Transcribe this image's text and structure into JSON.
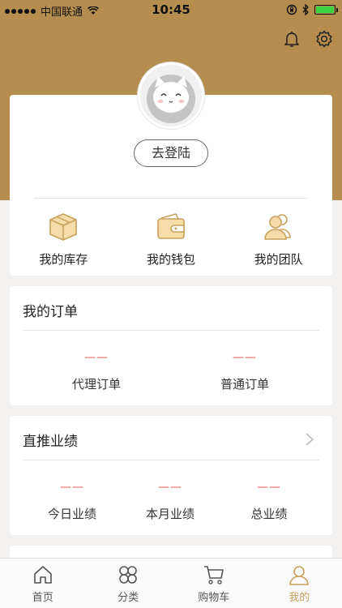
{
  "status_bar": {
    "carrier": "中国联通",
    "time": "10:45"
  },
  "profile": {
    "login_button": "去登陆"
  },
  "quick_links": [
    {
      "label": "我的库存",
      "icon": "box-icon"
    },
    {
      "label": "我的钱包",
      "icon": "wallet-icon"
    },
    {
      "label": "我的团队",
      "icon": "team-icon"
    }
  ],
  "orders": {
    "title": "我的订单",
    "items": [
      {
        "value": "——",
        "label": "代理订单"
      },
      {
        "value": "——",
        "label": "普通订单"
      }
    ]
  },
  "performance": {
    "title": "直推业绩",
    "items": [
      {
        "value": "——",
        "label": "今日业绩"
      },
      {
        "value": "——",
        "label": "本月业绩"
      },
      {
        "value": "——",
        "label": "总业绩"
      }
    ]
  },
  "tabs": [
    {
      "label": "首页",
      "icon": "home-icon"
    },
    {
      "label": "分类",
      "icon": "category-icon"
    },
    {
      "label": "购物车",
      "icon": "cart-icon"
    },
    {
      "label": "我的",
      "icon": "profile-icon"
    }
  ],
  "colors": {
    "header": "#b58d4f",
    "accent": "#c9a15c",
    "value": "#e05a5a"
  }
}
